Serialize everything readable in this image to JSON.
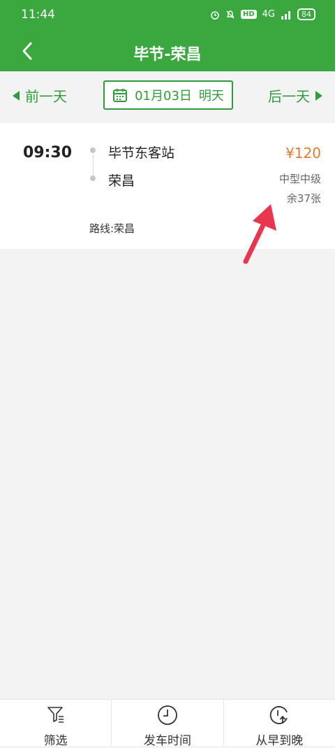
{
  "status": {
    "time": "11:44",
    "hd": "HD",
    "signal": "4G",
    "battery": "84"
  },
  "header": {
    "title": "毕节-荣昌"
  },
  "date_nav": {
    "prev": "前一天",
    "date": "01月03日",
    "relative": "明天",
    "next": "后一天"
  },
  "trip": {
    "departure_time": "09:30",
    "from": "毕节东客站",
    "to": "荣昌",
    "price": "¥120",
    "bus_type": "中型中级",
    "seats": "余37张",
    "route": "路线:荣昌"
  },
  "bottom_bar": {
    "filter": "筛选",
    "departure_time": "发车时间",
    "sort": "从早到晚"
  },
  "colors": {
    "brand": "#3aa83f",
    "price": "#e07a2e",
    "arrow": "#e8364e"
  }
}
